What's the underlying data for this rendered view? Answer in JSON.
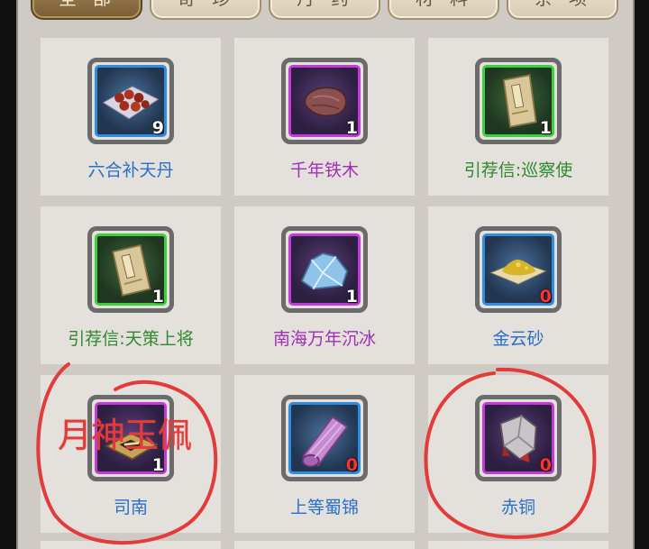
{
  "tabs": [
    {
      "label": "全部",
      "active": true
    },
    {
      "label": "奇珍",
      "active": false
    },
    {
      "label": "丹药",
      "active": false
    },
    {
      "label": "材料",
      "active": false
    },
    {
      "label": "杂项",
      "active": false
    }
  ],
  "items": [
    {
      "name": "六合补天丹",
      "count": "9",
      "quality": "blue",
      "icon": "pills-icon"
    },
    {
      "name": "千年铁木",
      "count": "1",
      "quality": "purple",
      "icon": "ironwood-icon"
    },
    {
      "name": "引荐信:巡察使",
      "count": "1",
      "quality": "green",
      "icon": "letter-icon"
    },
    {
      "name": "引荐信:天策上将",
      "count": "1",
      "quality": "green",
      "icon": "letter-icon"
    },
    {
      "name": "南海万年沉冰",
      "count": "1",
      "quality": "purple",
      "icon": "ice-icon"
    },
    {
      "name": "金云砂",
      "count": "0",
      "quality": "blue",
      "icon": "gold-sand-icon"
    },
    {
      "name": "司南",
      "count": "1",
      "quality": "purple",
      "icon": "compass-icon"
    },
    {
      "name": "上等蜀锦",
      "count": "0",
      "quality": "blue",
      "icon": "brocade-icon"
    },
    {
      "name": "赤铜",
      "count": "0",
      "quality": "purple",
      "icon": "copper-ore-icon"
    }
  ],
  "annotation": {
    "text": "月神玉佩",
    "color": "#e33a3a"
  },
  "colors": {
    "blue": "#2f8de0",
    "purple": "#c23bd9",
    "green": "#3ecf3e",
    "zero_count": "#ff3030"
  }
}
